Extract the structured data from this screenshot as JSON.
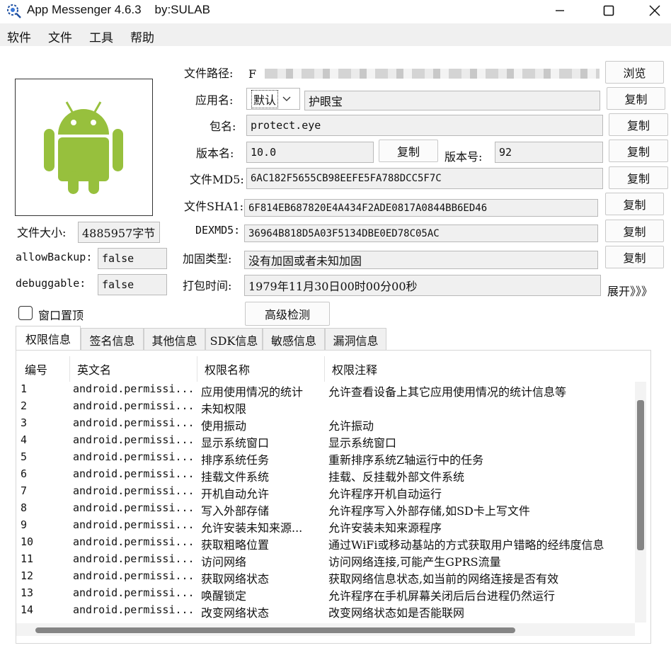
{
  "window": {
    "title": "App Messenger 4.6.3    by:SULAB",
    "minimize": "—",
    "maximize": "☐",
    "close": "✕"
  },
  "menu": [
    "软件",
    "文件",
    "工具",
    "帮助"
  ],
  "left": {
    "file_size_label": "文件大小:",
    "file_size_value": "4885957字节",
    "allow_backup_label": "allowBackup:",
    "allow_backup_value": "false",
    "debuggable_label": "debuggable:",
    "debuggable_value": "false",
    "pin_window_label": "窗口置顶",
    "pin_window_checked": false
  },
  "form": {
    "file_path_label": "文件路径:",
    "file_path_value": "F",
    "browse_button": "浏览",
    "app_name_label": "应用名:",
    "app_name_locale": "默认",
    "app_name_value": "护眼宝",
    "package_label": "包名:",
    "package_value": "protect.eye",
    "version_name_label": "版本名:",
    "version_name_value": "10.0",
    "version_code_label": "版本号:",
    "version_code_value": "92",
    "md5_label": "文件MD5:",
    "md5_value": "6AC182F5655CB98EEFE5FA788DCC5F7C",
    "sha1_label": "文件SHA1:",
    "sha1_value": "6F814EB687820E4A434F2ADE0817A0844BB6ED46",
    "dexmd5_label": "DEXMD5:",
    "dexmd5_value": "36964B818D5A03F5134DBE0ED78C05AC",
    "harden_label": "加固类型:",
    "harden_value": "没有加固或者未知加固",
    "pack_time_label": "打包时间:",
    "pack_time_value": "1979年11月30日00时00分00秒",
    "copy_button": "复制",
    "expand_link": "展开》》》",
    "advanced_button": "高级检测"
  },
  "tabs": [
    "权限信息",
    "签名信息",
    "其他信息",
    "SDK信息",
    "敏感信息",
    "漏洞信息"
  ],
  "table": {
    "columns": [
      "编号",
      "英文名",
      "权限名称",
      "权限注释"
    ],
    "rows": [
      {
        "id": "1",
        "en": "android.permissi...",
        "name": "应用使用情况的统计",
        "note": "允许查看设备上其它应用使用情况的统计信息等"
      },
      {
        "id": "2",
        "en": "android.permissi...",
        "name": "未知权限",
        "note": ""
      },
      {
        "id": "3",
        "en": "android.permissi...",
        "name": "使用振动",
        "note": "允许振动"
      },
      {
        "id": "4",
        "en": "android.permissi...",
        "name": "显示系统窗口",
        "note": "显示系统窗口"
      },
      {
        "id": "5",
        "en": "android.permissi...",
        "name": "排序系统任务",
        "note": "重新排序系统Z轴运行中的任务"
      },
      {
        "id": "6",
        "en": "android.permissi...",
        "name": "挂载文件系统",
        "note": "挂载、反挂载外部文件系统"
      },
      {
        "id": "7",
        "en": "android.permissi...",
        "name": "开机自动允许",
        "note": "允许程序开机自动运行"
      },
      {
        "id": "8",
        "en": "android.permissi...",
        "name": "写入外部存储",
        "note": "允许程序写入外部存储,如SD卡上写文件"
      },
      {
        "id": "9",
        "en": "android.permissi...",
        "name": "允许安装未知来源...",
        "note": "允许安装未知来源程序"
      },
      {
        "id": "10",
        "en": "android.permissi...",
        "name": "获取粗略位置",
        "note": "通过WiFi或移动基站的方式获取用户错略的经纬度信息"
      },
      {
        "id": "11",
        "en": "android.permissi...",
        "name": "访问网络",
        "note": "访问网络连接,可能产生GPRS流量"
      },
      {
        "id": "12",
        "en": "android.permissi...",
        "name": "获取网络状态",
        "note": "获取网络信息状态,如当前的网络连接是否有效"
      },
      {
        "id": "13",
        "en": "android.permissi...",
        "name": "唤醒锁定",
        "note": "允许程序在手机屏幕关闭后后台进程仍然运行"
      },
      {
        "id": "14",
        "en": "android.permissi...",
        "name": "改变网络状态",
        "note": "改变网络状态如是否能联网"
      }
    ]
  },
  "colors": {
    "android_green": "#97c03d",
    "menubar_bg": "#f0f0f0",
    "field_bg": "#f0f0f0",
    "scroll_thumb": "#858585"
  }
}
